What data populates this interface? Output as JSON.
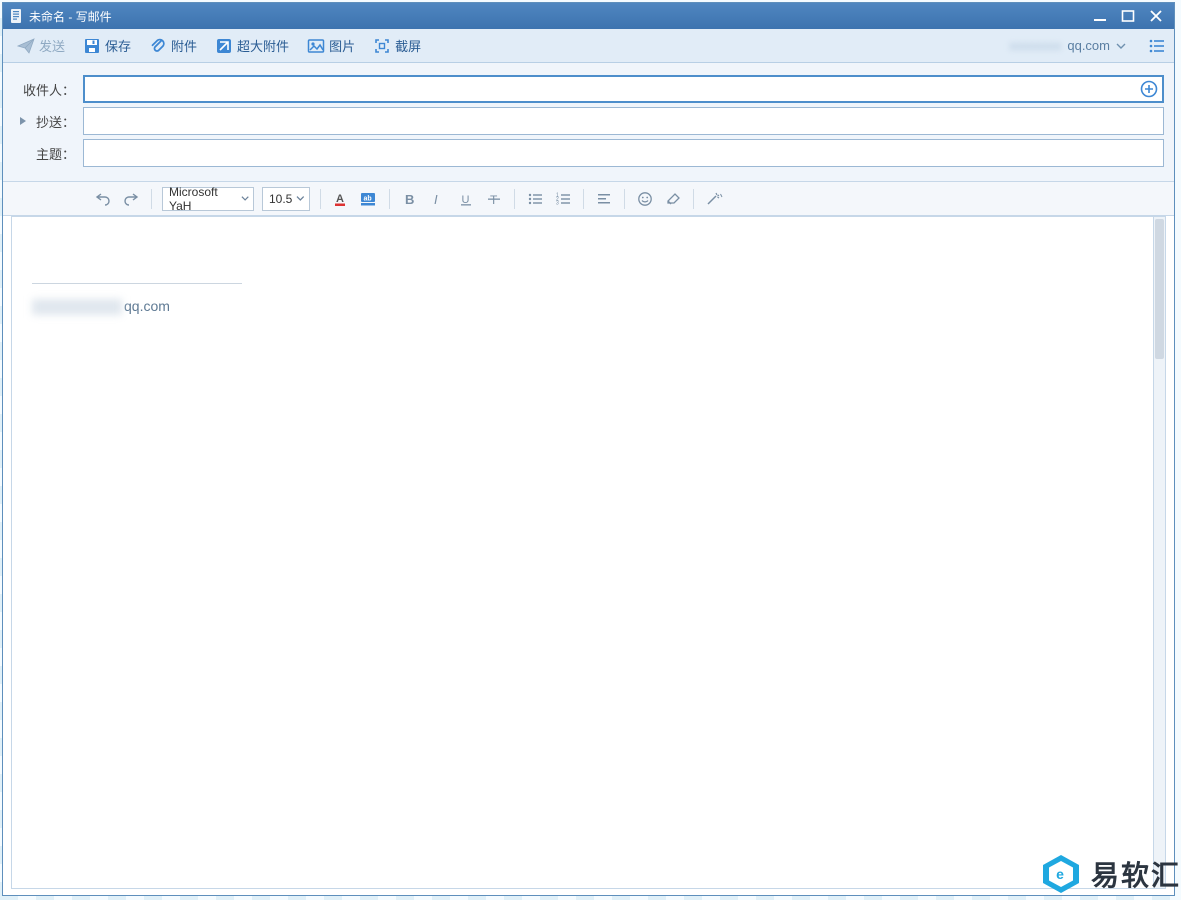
{
  "window": {
    "title": "未命名 - 写邮件"
  },
  "toolbar": {
    "send": "发送",
    "save": "保存",
    "attach": "附件",
    "big_attach": "超大附件",
    "image": "图片",
    "screenshot": "截屏"
  },
  "account": {
    "domain": "qq.com"
  },
  "fields": {
    "to_label": "收件人：",
    "cc_label": "抄送：",
    "subject_label": "主题：",
    "to_value": "",
    "cc_value": "",
    "subject_value": ""
  },
  "format": {
    "font_family": "Microsoft YaH",
    "font_size": "10.5"
  },
  "signature": {
    "email_domain": "qq.com"
  },
  "watermark": {
    "text": "易软汇"
  }
}
